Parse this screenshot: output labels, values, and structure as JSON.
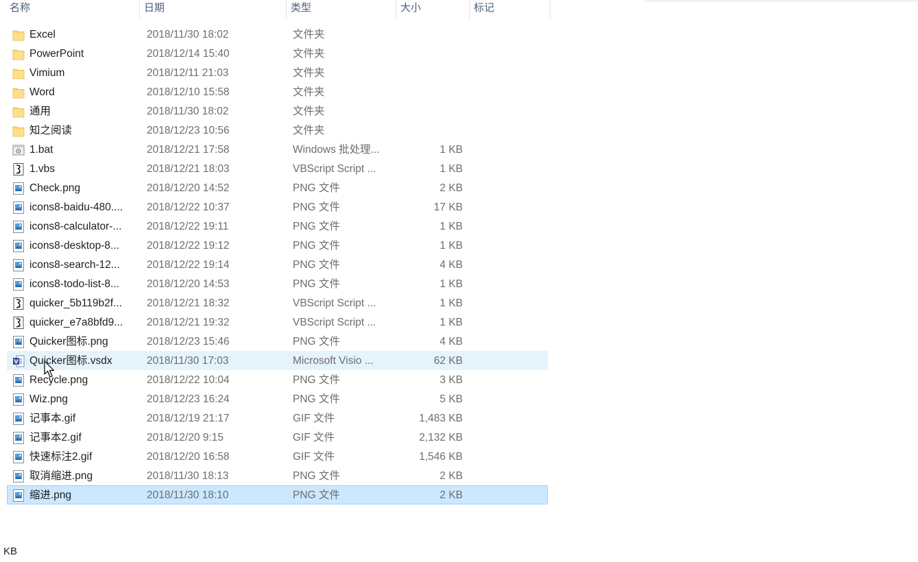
{
  "columns": {
    "name": "名称",
    "date": "日期",
    "type": "类型",
    "size": "大小",
    "tags": "标记"
  },
  "rows": [
    {
      "icon": "folder-icon",
      "name": "Excel",
      "date": "2018/11/30 18:02",
      "type": "文件夹",
      "size": ""
    },
    {
      "icon": "folder-icon",
      "name": "PowerPoint",
      "date": "2018/12/14 15:40",
      "type": "文件夹",
      "size": ""
    },
    {
      "icon": "folder-icon",
      "name": "Vimium",
      "date": "2018/12/11 21:03",
      "type": "文件夹",
      "size": ""
    },
    {
      "icon": "folder-icon",
      "name": "Word",
      "date": "2018/12/10 15:58",
      "type": "文件夹",
      "size": ""
    },
    {
      "icon": "folder-icon",
      "name": "通用",
      "date": "2018/11/30 18:02",
      "type": "文件夹",
      "size": ""
    },
    {
      "icon": "folder-icon",
      "name": "知之阅读",
      "date": "2018/12/23 10:56",
      "type": "文件夹",
      "size": ""
    },
    {
      "icon": "batch-file-icon",
      "name": "1.bat",
      "date": "2018/12/21 17:58",
      "type": "Windows 批处理...",
      "size": "1 KB"
    },
    {
      "icon": "script-file-icon",
      "name": "1.vbs",
      "date": "2018/12/21 18:03",
      "type": "VBScript Script ...",
      "size": "1 KB"
    },
    {
      "icon": "image-file-icon",
      "name": "Check.png",
      "date": "2018/12/20 14:52",
      "type": "PNG 文件",
      "size": "2 KB"
    },
    {
      "icon": "image-file-icon",
      "name": "icons8-baidu-480....",
      "date": "2018/12/22 10:37",
      "type": "PNG 文件",
      "size": "17 KB"
    },
    {
      "icon": "image-file-icon",
      "name": "icons8-calculator-...",
      "date": "2018/12/22 19:11",
      "type": "PNG 文件",
      "size": "1 KB"
    },
    {
      "icon": "image-file-icon",
      "name": "icons8-desktop-8...",
      "date": "2018/12/22 19:12",
      "type": "PNG 文件",
      "size": "1 KB"
    },
    {
      "icon": "image-file-icon",
      "name": "icons8-search-12...",
      "date": "2018/12/22 19:14",
      "type": "PNG 文件",
      "size": "4 KB"
    },
    {
      "icon": "image-file-icon",
      "name": "icons8-todo-list-8...",
      "date": "2018/12/20 14:53",
      "type": "PNG 文件",
      "size": "1 KB"
    },
    {
      "icon": "script-file-icon",
      "name": "quicker_5b119b2f...",
      "date": "2018/12/21 18:32",
      "type": "VBScript Script ...",
      "size": "1 KB"
    },
    {
      "icon": "script-file-icon",
      "name": "quicker_e7a8bfd9...",
      "date": "2018/12/21 19:32",
      "type": "VBScript Script ...",
      "size": "1 KB"
    },
    {
      "icon": "image-file-icon",
      "name": "Quicker图标.png",
      "date": "2018/12/23 15:46",
      "type": "PNG 文件",
      "size": "4 KB"
    },
    {
      "icon": "visio-file-icon",
      "name": "Quicker图标.vsdx",
      "date": "2018/11/30 17:03",
      "type": "Microsoft Visio ...",
      "size": "62 KB",
      "state": "hover"
    },
    {
      "icon": "image-file-icon",
      "name": "Recycle.png",
      "date": "2018/12/22 10:04",
      "type": "PNG 文件",
      "size": "3 KB"
    },
    {
      "icon": "image-file-icon",
      "name": "Wiz.png",
      "date": "2018/12/23 16:24",
      "type": "PNG 文件",
      "size": "5 KB"
    },
    {
      "icon": "image-file-icon",
      "name": "记事本.gif",
      "date": "2018/12/19 21:17",
      "type": "GIF 文件",
      "size": "1,483 KB"
    },
    {
      "icon": "image-file-icon",
      "name": "记事本2.gif",
      "date": "2018/12/20 9:15",
      "type": "GIF 文件",
      "size": "2,132 KB"
    },
    {
      "icon": "image-file-icon",
      "name": "快速标注2.gif",
      "date": "2018/12/20 16:58",
      "type": "GIF 文件",
      "size": "1,546 KB"
    },
    {
      "icon": "image-file-icon",
      "name": "取消缩进.png",
      "date": "2018/11/30 18:13",
      "type": "PNG 文件",
      "size": "2 KB"
    },
    {
      "icon": "image-file-icon",
      "name": "缩进.png",
      "date": "2018/11/30 18:10",
      "type": "PNG 文件",
      "size": "2 KB",
      "state": "selected"
    }
  ],
  "status_bar": {
    "text": "KB"
  },
  "colors": {
    "selected_bg": "#cce8ff",
    "selected_border": "#99d1ff",
    "hover_bg": "#e5f3fb",
    "folder_yellow": "#f8d775"
  }
}
